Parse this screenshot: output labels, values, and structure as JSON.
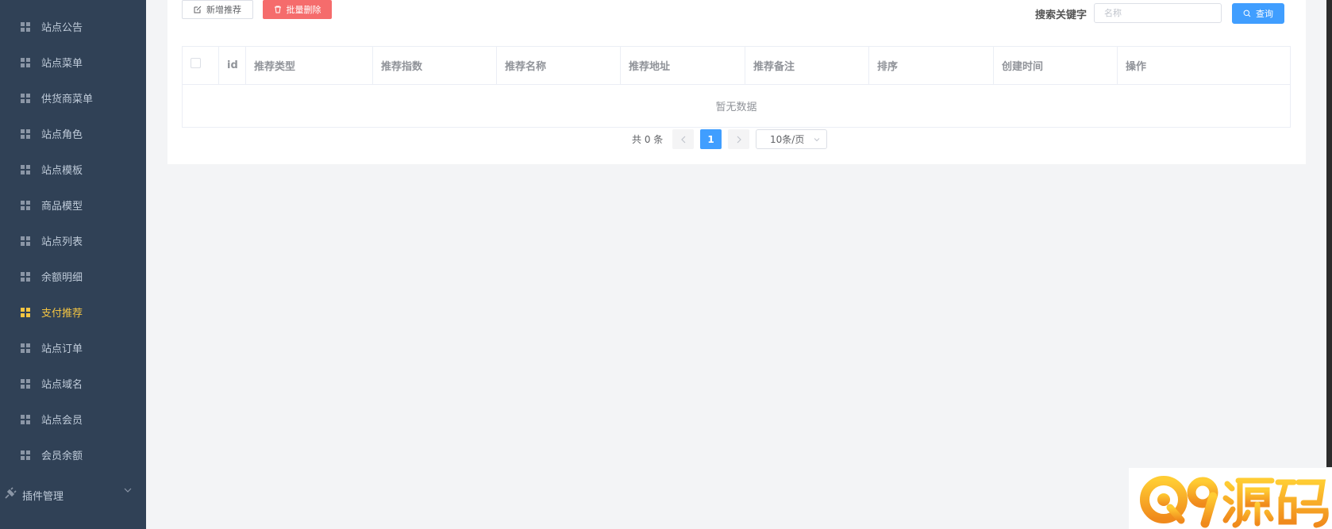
{
  "sidebar": {
    "items": [
      {
        "label": "站点公告",
        "active": false
      },
      {
        "label": "站点菜单",
        "active": false
      },
      {
        "label": "供货商菜单",
        "active": false
      },
      {
        "label": "站点角色",
        "active": false
      },
      {
        "label": "站点模板",
        "active": false
      },
      {
        "label": "商品模型",
        "active": false
      },
      {
        "label": "站点列表",
        "active": false
      },
      {
        "label": "余额明细",
        "active": false
      },
      {
        "label": "支付推荐",
        "active": true
      },
      {
        "label": "站点订单",
        "active": false
      },
      {
        "label": "站点域名",
        "active": false
      },
      {
        "label": "站点会员",
        "active": false
      },
      {
        "label": "会员余额",
        "active": false
      }
    ],
    "group": {
      "label": "插件管理"
    }
  },
  "toolbar": {
    "add_label": "新增推荐",
    "batch_delete_label": "批量删除",
    "search_label": "搜索关键字",
    "search_placeholder": "名称",
    "query_label": "查询"
  },
  "table": {
    "columns": [
      "id",
      "推荐类型",
      "推荐指数",
      "推荐名称",
      "推荐地址",
      "推荐备注",
      "排序",
      "创建时间",
      "操作"
    ],
    "empty_text": "暂无数据"
  },
  "pagination": {
    "total_text": "共 0 条",
    "current_page": "1",
    "page_size": "10条/页"
  },
  "watermark": {
    "text": "Q9源码"
  },
  "colors": {
    "sidebar_bg": "#304156",
    "active": "#f4c542",
    "primary": "#409eff",
    "danger": "#f56c6c"
  }
}
